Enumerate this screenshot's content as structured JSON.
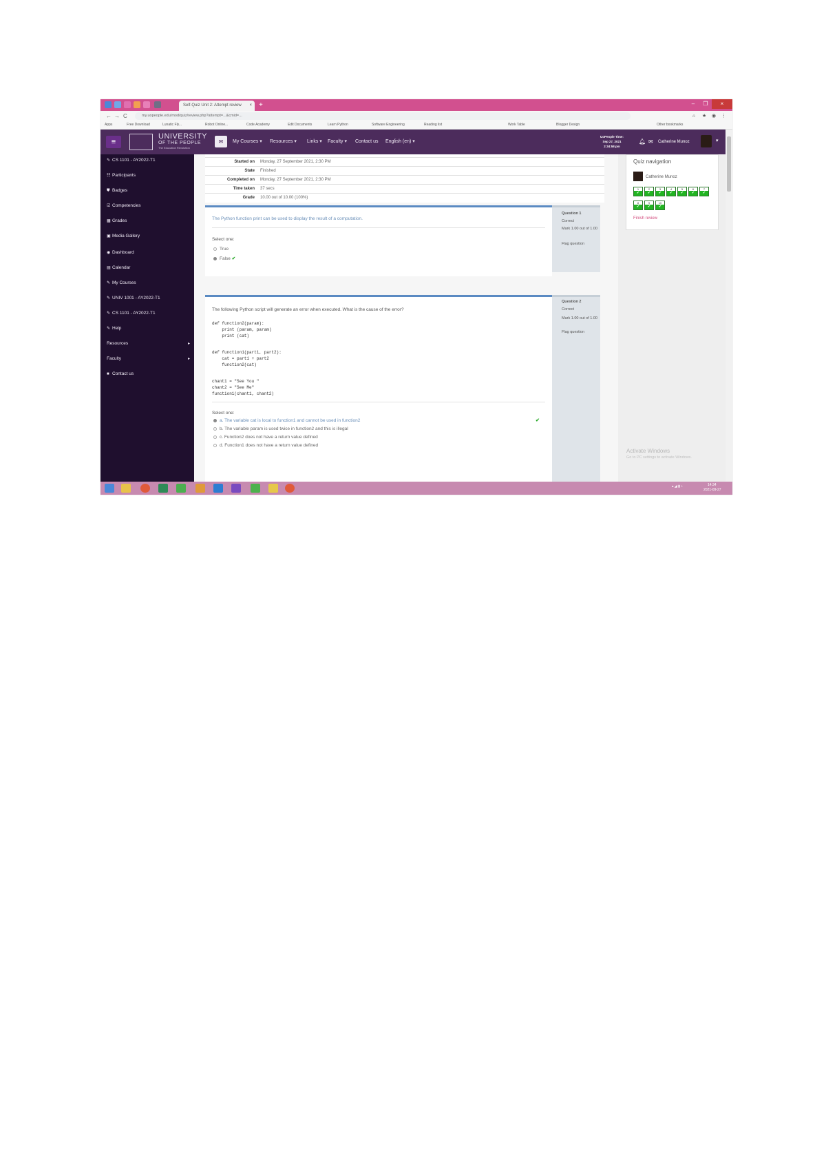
{
  "browser": {
    "tab_title": "Self-Quiz Unit 2: Attempt review",
    "tab_close": "×",
    "new_tab": "+",
    "address": "my.uopeople.edu/mod/quiz/review.php?attempt=...&cmid=...",
    "nav": {
      "back": "←",
      "forward": "→",
      "reload": "C"
    },
    "win": {
      "min": "–",
      "max": "❐",
      "close": "×"
    },
    "bookmarks": [
      "Apps",
      "Free Download",
      "Lunatic Fly...",
      "Robot Online...",
      "Code Academy",
      "Edit Documents",
      "Learn Python",
      "Software Engineering",
      "Reading list",
      "Work Table",
      "Blogger Design",
      "Other bookmarks"
    ]
  },
  "site": {
    "logo_line1": "UNIVERSITY",
    "logo_line2": "OF THE PEOPLE",
    "logo_line3": "The Education Revolution",
    "menu": [
      "My Courses ▾",
      "Resources ▾",
      "Links ▾",
      "Faculty ▾",
      "Contact us",
      "English (en) ▾"
    ],
    "time_label": "UoPeople Time:",
    "time_date": "Sep 27, 2021",
    "time_clock": "2:34:58 pm",
    "user_name": "Catherine Munoz"
  },
  "sidebar": {
    "items": [
      {
        "icon": "✎",
        "label": "CS 1101 - AY2022-T1"
      },
      {
        "icon": "☷",
        "label": "Participants"
      },
      {
        "icon": "⛊",
        "label": "Badges"
      },
      {
        "icon": "☑",
        "label": "Competencies"
      },
      {
        "icon": "▦",
        "label": "Grades"
      },
      {
        "icon": "▣",
        "label": "Media Gallery"
      },
      {
        "icon": "◉",
        "label": "Dashboard"
      },
      {
        "icon": "▤",
        "label": "Calendar"
      },
      {
        "icon": "✎",
        "label": "My Courses"
      },
      {
        "icon": "✎",
        "label": "UNIV 1001 - AY2022-T1"
      },
      {
        "icon": "✎",
        "label": "CS 1101 - AY2022-T1"
      },
      {
        "icon": "✎",
        "label": "Help"
      },
      {
        "icon": "",
        "label": "Resources"
      },
      {
        "icon": "",
        "label": "Faculty"
      },
      {
        "icon": "■",
        "label": "Contact us"
      }
    ]
  },
  "summary": {
    "rows": [
      {
        "k": "Started on",
        "v": "Monday, 27 September 2021, 2:30 PM"
      },
      {
        "k": "State",
        "v": "Finished"
      },
      {
        "k": "Completed on",
        "v": "Monday, 27 September 2021, 2:30 PM"
      },
      {
        "k": "Time taken",
        "v": "37 secs"
      },
      {
        "k": "Grade",
        "v": "10.00 out of 10.00 (100%)"
      }
    ]
  },
  "q1": {
    "label": "Question 1",
    "status": "Correct",
    "mark": "Mark 1.00 out of 1.00",
    "flag": "Flag question",
    "text": "The Python function print can be used to display the result of a computation.",
    "select": "Select one:",
    "opt_true": "True",
    "opt_false": "False",
    "check": "✔"
  },
  "q2": {
    "label": "Question 2",
    "status": "Correct",
    "mark": "Mark 1.00 out of 1.00",
    "flag": "Flag question",
    "text": "The following Python script will generate an error when executed. What is the cause of the error?",
    "code1": "def function2(param):\n    print (param, param)\n    print (cat)",
    "code2": "def function1(part1, part2):\n    cat = part1 + part2\n    function2(cat)",
    "code3": "chant1 = \"See You \"\nchant2 = \"See Me\"\nfunction1(chant1, chant2)",
    "select": "Select one:",
    "options": [
      "a. The variable cat is local to function1 and cannot be used in function2",
      "b. The variable param is used twice in function2 and this is illegal",
      "c. Function2 does not have a return value defined",
      "d. Function1 does not have a return value defined"
    ],
    "check": "✔"
  },
  "quiz_nav": {
    "title": "Quiz navigation",
    "user": "Catherine Munoz",
    "questions": [
      "1",
      "2",
      "3",
      "4",
      "5",
      "6",
      "7",
      "8",
      "9",
      "10"
    ],
    "mark": "✔",
    "finish": "Finish review"
  },
  "watermark": {
    "title": "Activate Windows",
    "sub": "Go to PC settings to activate Windows."
  },
  "taskbar": {
    "clock": "14:34",
    "date": "2021-09-27"
  },
  "colors": {
    "tabstrip": "#d2508f",
    "site_nav": "#4c2c5c",
    "sidebar": "#1f0f2e",
    "correct_green": "#22b422",
    "question_accent": "#5a8ac2"
  }
}
